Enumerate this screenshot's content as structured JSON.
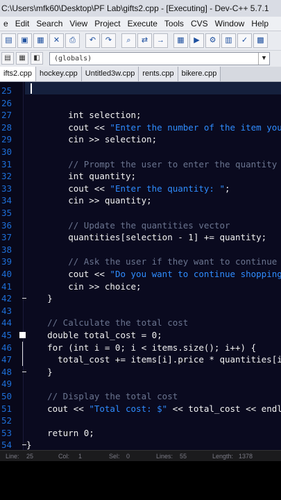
{
  "window": {
    "title": "C:\\Users\\mfk60\\Desktop\\PF Lab\\gifts2.cpp - [Executing] - Dev-C++ 5.7.1"
  },
  "menu": [
    "e",
    "Edit",
    "Search",
    "View",
    "Project",
    "Execute",
    "Tools",
    "CVS",
    "Window",
    "Help"
  ],
  "toolbar": {
    "globals_value": "(globals)"
  },
  "tabs": [
    "ifts2.cpp",
    "hockey.cpp",
    "Untitled3w.cpp",
    "rents.cpp",
    "bikere.cpp"
  ],
  "line_numbers": [
    "25",
    "26",
    "27",
    "28",
    "29",
    "30",
    "31",
    "32",
    "33",
    "34",
    "35",
    "36",
    "37",
    "38",
    "39",
    "40",
    "41",
    "42",
    "43",
    "44",
    "45",
    "46",
    "47",
    "48",
    "49",
    "50",
    "51",
    "52",
    "53",
    "54",
    "55"
  ],
  "code_lines": [
    "",
    "",
    "        int selection;",
    "        cout << \"Enter the number of the item you w",
    "        cin >> selection;",
    "",
    "        // Prompt the user to enter the quantity",
    "        int quantity;",
    "        cout << \"Enter the quantity: \";",
    "        cin >> quantity;",
    "",
    "        // Update the quantities vector",
    "        quantities[selection - 1] += quantity;",
    "",
    "        // Ask the user if they want to continue sh",
    "        cout << \"Do you want to continue shopping? ",
    "        cin >> choice;",
    "    }",
    "",
    "    // Calculate the total cost",
    "    double total_cost = 0;",
    "    for (int i = 0; i < items.size(); i++) {",
    "      total_cost += items[i].price * quantities[i]",
    "    }",
    "",
    "    // Display the total cost",
    "    cout << \"Total cost: $\" << total_cost << endl;",
    "",
    "    return 0;",
    "}",
    ""
  ],
  "status": {
    "line_label": "Line:",
    "line_value": "25",
    "col_label": "Col:",
    "col_value": "1",
    "sel_label": "Sel:",
    "sel_value": "0",
    "lines_label": "Lines:",
    "lines_value": "55",
    "length_label": "Length:",
    "length_value": "1378"
  }
}
